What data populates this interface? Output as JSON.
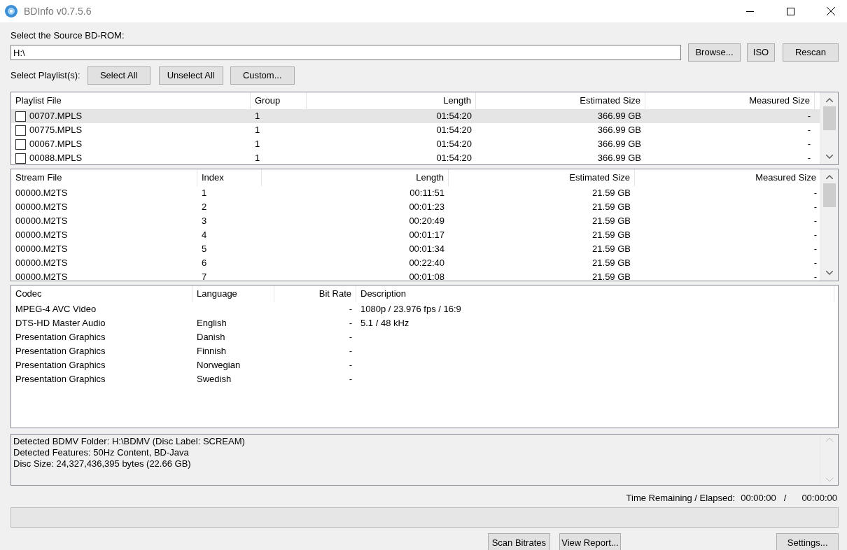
{
  "window": {
    "title": "BDInfo v0.7.5.6"
  },
  "source": {
    "label": "Select the Source BD-ROM:",
    "value": "H:\\",
    "buttons": [
      "Browse...",
      "ISO",
      "Rescan"
    ]
  },
  "playlist_select": {
    "label": "Select Playlist(s):",
    "buttons": [
      "Select All",
      "Unselect All",
      "Custom..."
    ]
  },
  "playlists": {
    "columns": [
      "Playlist File",
      "Group",
      "Length",
      "Estimated Size",
      "Measured Size"
    ],
    "rows": [
      {
        "file": "00707.MPLS",
        "group": "1",
        "length": "01:54:20",
        "estimated_size": "366.99 GB",
        "measured_size": "-",
        "checked": false,
        "selected": true
      },
      {
        "file": "00775.MPLS",
        "group": "1",
        "length": "01:54:20",
        "estimated_size": "366.99 GB",
        "measured_size": "-",
        "checked": false,
        "selected": false
      },
      {
        "file": "00067.MPLS",
        "group": "1",
        "length": "01:54:20",
        "estimated_size": "366.99 GB",
        "measured_size": "-",
        "checked": false,
        "selected": false
      },
      {
        "file": "00088.MPLS",
        "group": "1",
        "length": "01:54:20",
        "estimated_size": "366.99 GB",
        "measured_size": "-",
        "checked": false,
        "selected": false
      }
    ]
  },
  "streams": {
    "columns": [
      "Stream File",
      "Index",
      "Length",
      "Estimated Size",
      "Measured Size"
    ],
    "rows": [
      [
        "00000.M2TS",
        "1",
        "00:11:51",
        "21.59 GB",
        "-"
      ],
      [
        "00000.M2TS",
        "2",
        "00:01:23",
        "21.59 GB",
        "-"
      ],
      [
        "00000.M2TS",
        "3",
        "00:20:49",
        "21.59 GB",
        "-"
      ],
      [
        "00000.M2TS",
        "4",
        "00:01:17",
        "21.59 GB",
        "-"
      ],
      [
        "00000.M2TS",
        "5",
        "00:01:34",
        "21.59 GB",
        "-"
      ],
      [
        "00000.M2TS",
        "6",
        "00:22:40",
        "21.59 GB",
        "-"
      ],
      [
        "00000.M2TS",
        "7",
        "00:01:08",
        "21.59 GB",
        "-"
      ]
    ]
  },
  "codecs": {
    "columns": [
      "Codec",
      "Language",
      "Bit Rate",
      "Description"
    ],
    "rows": [
      [
        "MPEG-4 AVC Video",
        "",
        "-",
        "1080p / 23.976 fps / 16:9"
      ],
      [
        "DTS-HD Master Audio",
        "English",
        "-",
        "5.1 / 48 kHz"
      ],
      [
        "Presentation Graphics",
        "Danish",
        "-",
        ""
      ],
      [
        "Presentation Graphics",
        "Finnish",
        "-",
        ""
      ],
      [
        "Presentation Graphics",
        "Norwegian",
        "-",
        ""
      ],
      [
        "Presentation Graphics",
        "Swedish",
        "-",
        ""
      ]
    ]
  },
  "info": [
    "Detected BDMV Folder: H:\\BDMV (Disc Label: SCREAM)",
    "Detected Features: 50Hz Content, BD-Java",
    "Disc Size: 24,327,436,395 bytes (22.66 GB)"
  ],
  "timer": {
    "label": "Time Remaining / Elapsed:",
    "remaining": "00:00:00",
    "separator": "/",
    "elapsed": "00:00:00"
  },
  "progress": {
    "level": 0
  },
  "bottom_buttons": [
    "Scan Bitrates",
    "View Report...",
    "Settings..."
  ]
}
